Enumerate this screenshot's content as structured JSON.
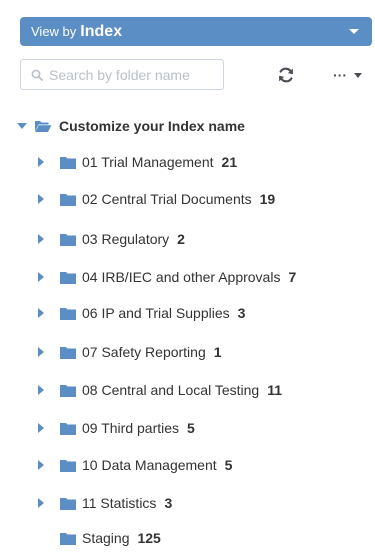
{
  "view_by": {
    "label": "View by",
    "value": "Index"
  },
  "search": {
    "placeholder": "Search by folder name"
  },
  "toolbar": {
    "more_label": "···"
  },
  "tree": {
    "root_label": "Customize your Index name",
    "folders": [
      {
        "label": "01 Trial Management",
        "count": "21"
      },
      {
        "label": "02 Central Trial Documents",
        "count": "19"
      },
      {
        "label": "03 Regulatory",
        "count": "2"
      },
      {
        "label": "04 IRB/IEC and other Approvals",
        "count": "7"
      },
      {
        "label": "06 IP and Trial Supplies",
        "count": "3"
      },
      {
        "label": "07 Safety Reporting",
        "count": "1"
      },
      {
        "label": "08 Central and Local Testing",
        "count": "11"
      },
      {
        "label": "09 Third parties",
        "count": "5"
      },
      {
        "label": "10 Data Management",
        "count": "5"
      },
      {
        "label": "11 Statistics",
        "count": "3"
      },
      {
        "label": "Staging",
        "count": "125"
      }
    ]
  },
  "colors": {
    "accent": "#5b8ec4",
    "text": "#333333",
    "border": "#cfd5dc"
  }
}
